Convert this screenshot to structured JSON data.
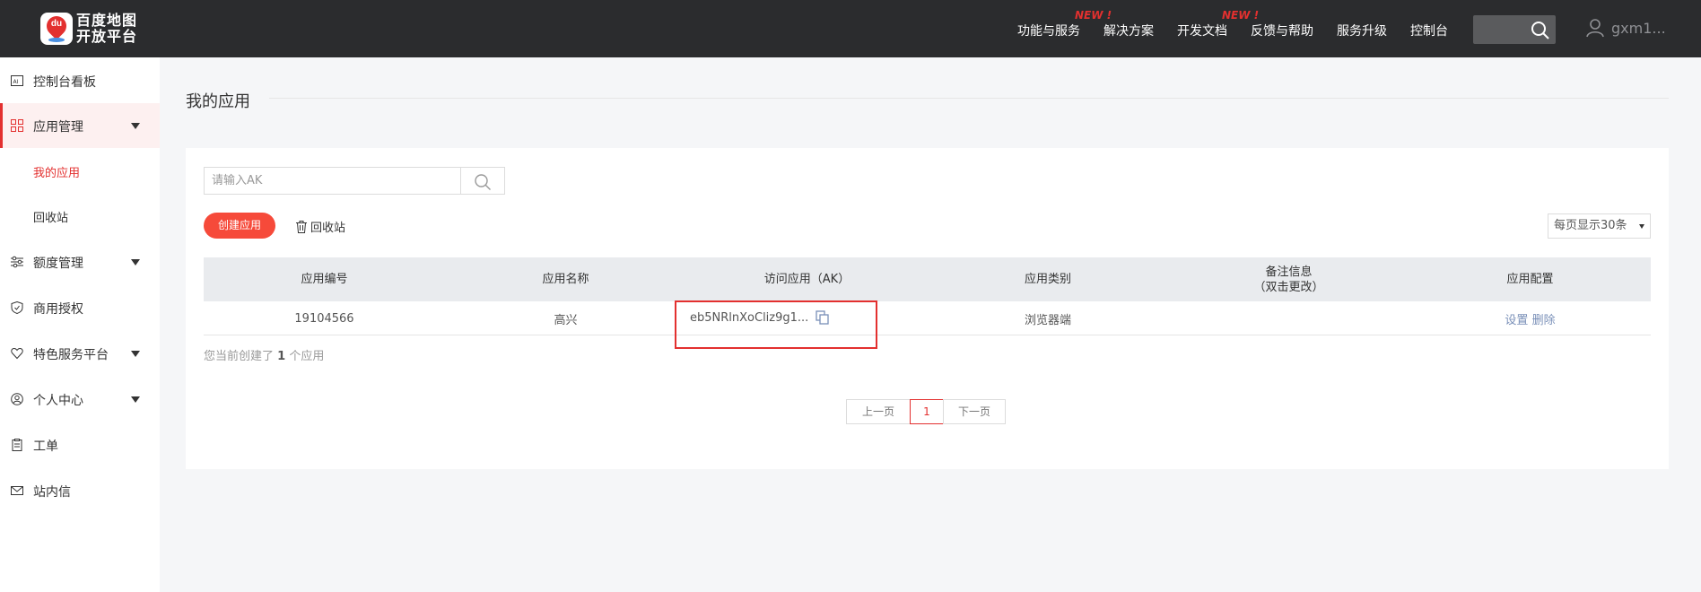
{
  "brand": {
    "line1": "百度地图",
    "line2": "开放平台",
    "mark": "du"
  },
  "topnav": {
    "items": [
      {
        "label": "功能与服务",
        "badge": "NEW !"
      },
      {
        "label": "解决方案",
        "badge": ""
      },
      {
        "label": "开发文档",
        "badge": "NEW !"
      },
      {
        "label": "反馈与帮助",
        "badge": ""
      },
      {
        "label": "服务升级",
        "badge": ""
      },
      {
        "label": "控制台",
        "badge": ""
      }
    ],
    "search_placeholder": "",
    "username": "gxm1..."
  },
  "sidebar": {
    "items": [
      {
        "label": "控制台看板",
        "icon": "dashboard-icon"
      },
      {
        "label": "应用管理",
        "icon": "grid-icon",
        "expanded": true
      },
      {
        "label": "额度管理",
        "icon": "sliders-icon"
      },
      {
        "label": "商用授权",
        "icon": "shield-icon"
      },
      {
        "label": "特色服务平台",
        "icon": "heart-icon"
      },
      {
        "label": "个人中心",
        "icon": "user-circle-icon"
      },
      {
        "label": "工单",
        "icon": "clipboard-icon"
      },
      {
        "label": "站内信",
        "icon": "mail-icon"
      }
    ],
    "sub_items": [
      {
        "label": "我的应用",
        "current": true
      },
      {
        "label": "回收站",
        "current": false
      }
    ]
  },
  "main": {
    "title": "我的应用",
    "ak_search_placeholder": "请输入AK",
    "create_label": "创建应用",
    "recycle_label": "回收站",
    "page_size_label": "每页显示30条",
    "columns": [
      "应用编号",
      "应用名称",
      "访问应用（AK）",
      "应用类别",
      "备注信息",
      "（双击更改）",
      "应用配置"
    ],
    "rows": [
      {
        "id": "19104566",
        "name": "高兴",
        "ak": "eb5NRlnXoCliz9g1...",
        "category": "浏览器端",
        "note": "",
        "op_settings": "设置",
        "op_delete": "删除"
      }
    ],
    "count_prefix": "您当前创建了",
    "count_value": "1",
    "count_suffix": "个应用",
    "pager": {
      "prev": "上一页",
      "current": "1",
      "next": "下一页"
    }
  },
  "colors": {
    "accent": "#e3302f",
    "topbar": "#2b2c2e",
    "button": "#f64a3a",
    "link": "#7a90b8"
  }
}
